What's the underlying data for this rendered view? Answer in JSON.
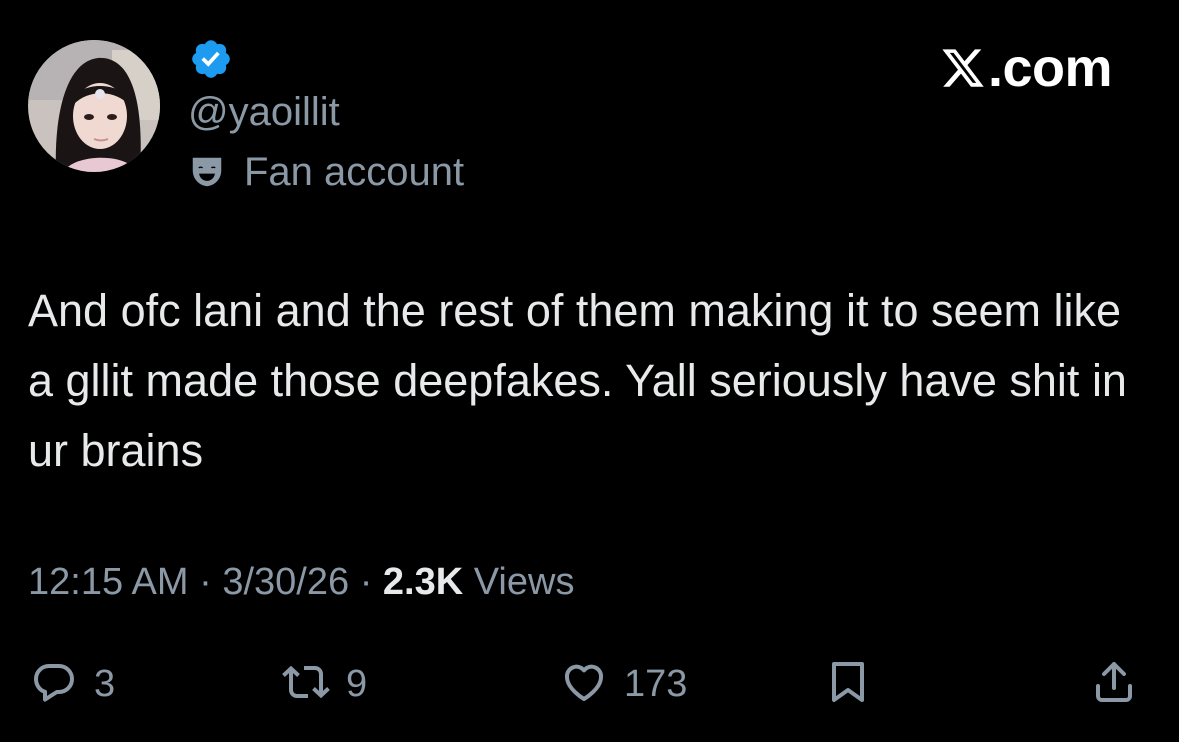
{
  "brand": {
    "logo_icon": "x-logo-icon",
    "text": ".com"
  },
  "author": {
    "avatar_icon": "profile-avatar",
    "verified_icon": "verified-badge-icon",
    "handle": "@yaoillit",
    "label_icon": "theater-mask-icon",
    "label": "Fan account"
  },
  "tweet": {
    "text": "And ofc lani and the rest of them making it to seem like a gllit made those deepfakes. Yall seriously have shit in ur brains"
  },
  "meta": {
    "time": "12:15 AM",
    "separator": "·",
    "date": "3/30/26",
    "views_count": "2.3K",
    "views_label": "Views"
  },
  "actions": {
    "reply": {
      "icon": "reply-icon",
      "count": "3"
    },
    "retweet": {
      "icon": "retweet-icon",
      "count": "9"
    },
    "like": {
      "icon": "heart-icon",
      "count": "173"
    },
    "bookmark": {
      "icon": "bookmark-icon"
    },
    "share": {
      "icon": "share-icon"
    }
  },
  "colors": {
    "background": "#000000",
    "text_primary": "#e7e9ea",
    "text_secondary": "#8b98a5",
    "verified_blue": "#1d9bf0"
  }
}
